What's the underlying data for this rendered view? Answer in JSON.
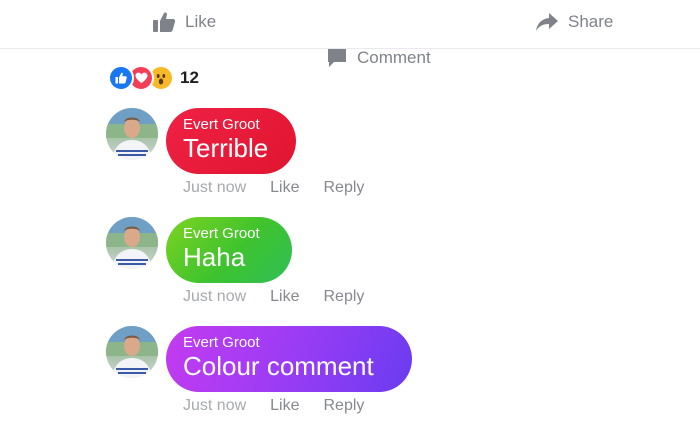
{
  "actions": {
    "like_label": "Like",
    "comment_label": "Comment",
    "share_label": "Share",
    "icon_color": "#7f8389"
  },
  "reactions": {
    "icons": [
      "like-icon",
      "love-icon",
      "wow-icon"
    ],
    "count": "12"
  },
  "comments": [
    {
      "author": "Evert Groot",
      "text": "Terrible",
      "time": "Just now",
      "like_label": "Like",
      "reply_label": "Reply",
      "bubble_color": "#e8173a"
    },
    {
      "author": "Evert Groot",
      "text": "Haha",
      "time": "Just now",
      "like_label": "Like",
      "reply_label": "Reply",
      "bubble_color": "#5cc92a"
    },
    {
      "author": "Evert Groot",
      "text": "Colour comment",
      "time": "Just now",
      "like_label": "Like",
      "reply_label": "Reply",
      "bubble_color": "#9b3cf5"
    }
  ]
}
